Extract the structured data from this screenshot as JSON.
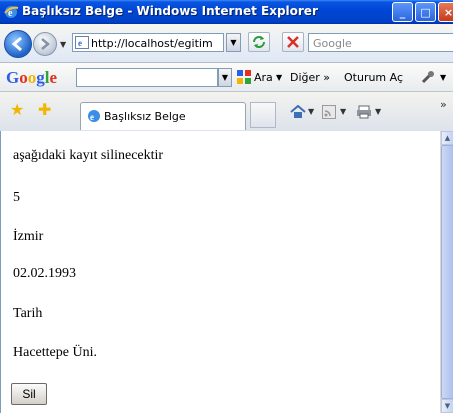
{
  "window": {
    "title": "Başlıksız Belge - Windows Internet Explorer",
    "buttons": {
      "minimize": "_",
      "maximize": "□",
      "close": "×"
    }
  },
  "address_bar": {
    "url": "http://localhost/egitim",
    "search_placeholder": "Google"
  },
  "google_toolbar": {
    "logo_letters": [
      {
        "char": "G",
        "color": "#2a5ee8"
      },
      {
        "char": "o",
        "color": "#e0321e"
      },
      {
        "char": "o",
        "color": "#f2b600"
      },
      {
        "char": "g",
        "color": "#2a5ee8"
      },
      {
        "char": "l",
        "color": "#2fa23a"
      },
      {
        "char": "e",
        "color": "#e0321e"
      }
    ],
    "search_label": "Ara",
    "more_label": "Diğer »",
    "signin_label": "Oturum Aç"
  },
  "tab_bar": {
    "active_tab_label": "Başlıksız Belge",
    "icons": [
      "favorites-star-icon",
      "add-favorites-icon",
      "home-icon",
      "feeds-icon",
      "print-icon"
    ]
  },
  "page": {
    "lines": [
      "aşağıdaki kayıt silinecektir",
      "5",
      "İzmir",
      "02.02.1993",
      "Tarih",
      "Hacettepe Üni."
    ],
    "delete_button_label": "Sil"
  },
  "colors": {
    "titlebar_blue": "#0047d6",
    "content_background": "#ffffff"
  }
}
